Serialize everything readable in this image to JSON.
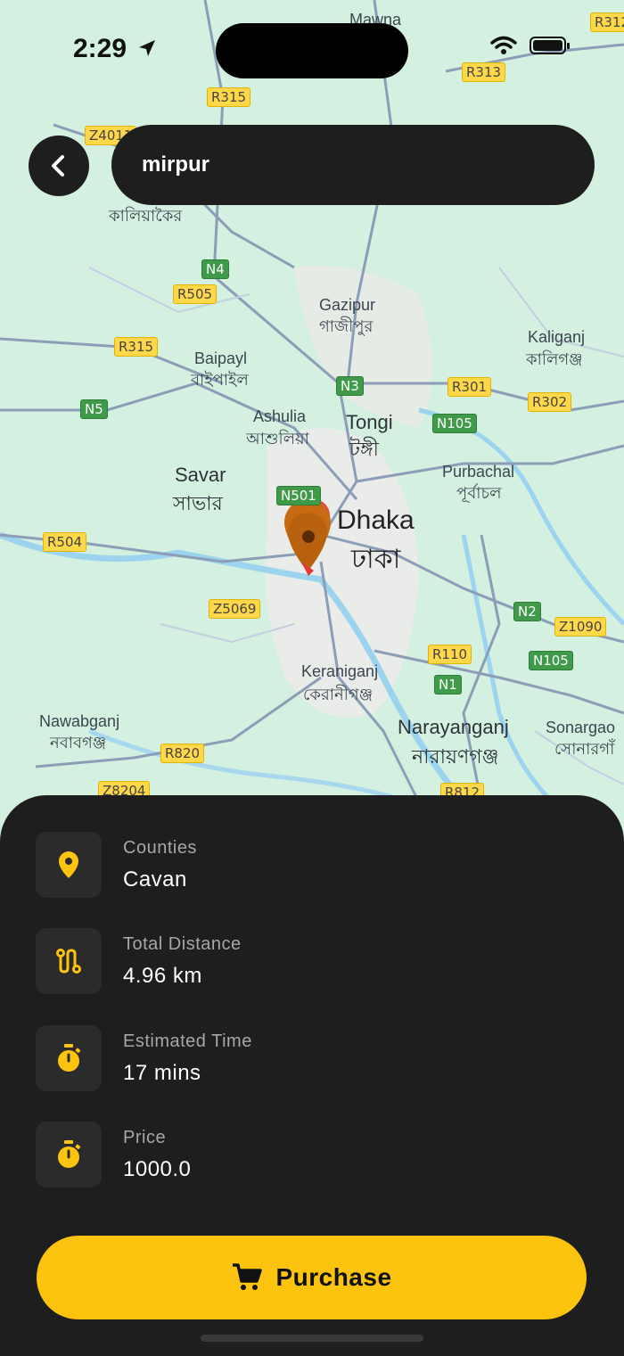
{
  "status_bar": {
    "time": "2:29"
  },
  "search": {
    "value": "mirpur"
  },
  "map": {
    "labels": {
      "mawna": "Mawna",
      "kaliakair": "কালিয়াকৈর",
      "gazipur_en": "Gazipur",
      "gazipur_bn": "গাজীপুর",
      "kaliganj_en": "Kaliganj",
      "kaliganj_bn": "কালিগঞ্জ",
      "baipayl_en": "Baipayl",
      "baipayl_bn": "বাইপাইল",
      "ashulia_en": "Ashulia",
      "ashulia_bn": "আশুলিয়া",
      "tongi_en": "Tongi",
      "tongi_bn": "টঙ্গী",
      "purbachal_en": "Purbachal",
      "purbachal_bn": "পূর্বাচল",
      "savar_en": "Savar",
      "savar_bn": "সাভার",
      "dhaka_en": "Dhaka",
      "dhaka_bn": "ঢাকা",
      "keraniganj_en": "Keraniganj",
      "keraniganj_bn": "কেরানীগঞ্জ",
      "nawabganj_en": "Nawabganj",
      "nawabganj_bn": "নবাবগঞ্জ",
      "narayanganj_en": "Narayanganj",
      "narayanganj_bn": "নারায়ণগঞ্জ",
      "sonargaon_en": "Sonargao",
      "sonargaon_bn": "সোনারগাঁ"
    },
    "shields": {
      "r315a": "R315",
      "r313": "R313",
      "r312": "R312",
      "z4011": "Z4011",
      "n4": "N4",
      "r505": "R505",
      "r315b": "R315",
      "n3": "N3",
      "r301": "R301",
      "r302": "R302",
      "n5": "N5",
      "n105a": "N105",
      "n501": "N501",
      "r504": "R504",
      "z5069": "Z5069",
      "n2": "N2",
      "z1090": "Z1090",
      "r110": "R110",
      "n105b": "N105",
      "n1": "N1",
      "r820": "R820",
      "z8204": "Z8204",
      "r812": "R812"
    }
  },
  "details": {
    "counties": {
      "label": "Counties",
      "value": "Cavan",
      "icon": "location-pin-icon"
    },
    "distance": {
      "label": "Total Distance",
      "value": "4.96 km",
      "icon": "route-icon"
    },
    "time": {
      "label": "Estimated Time",
      "value": "17 mins",
      "icon": "stopwatch-icon"
    },
    "price": {
      "label": "Price",
      "value": "1000.0",
      "icon": "stopwatch-icon"
    }
  },
  "purchase": {
    "label": "Purchase",
    "icon": "cart-icon"
  },
  "colors": {
    "accent": "#fcc40f",
    "panel": "#1e1e1e",
    "tile": "#2b2b2b"
  }
}
